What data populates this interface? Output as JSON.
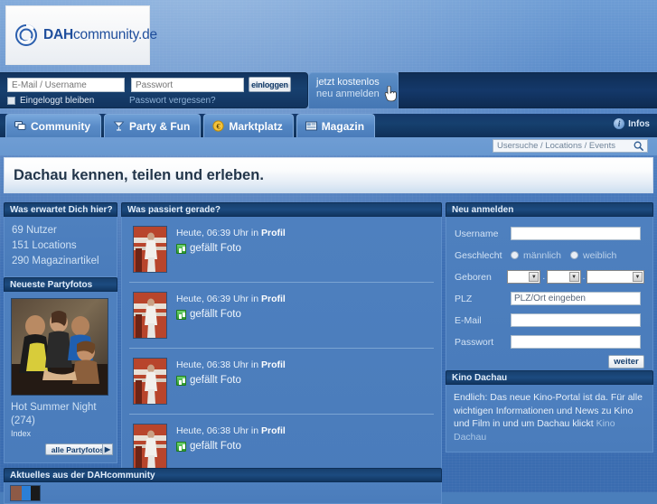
{
  "site": {
    "logo_main": "DAH",
    "logo_rest": "community.de",
    "logo_icon": "spiral-logo-icon"
  },
  "login": {
    "email_placeholder": "E-Mail / Username",
    "email_value": "",
    "password_placeholder": "Passwort",
    "password_value": "",
    "submit_label": "einloggen",
    "stay_logged_label": "Eingeloggt bleiben",
    "forgot_label": "Passwort vergessen?"
  },
  "cta": {
    "line1": "jetzt kostenlos",
    "line2": "neu anmelden",
    "cursor": "pointer-hand-cursor"
  },
  "nav": {
    "tabs": [
      {
        "label": "Community",
        "icon": "chat-bubbles-icon",
        "active": true
      },
      {
        "label": "Party & Fun",
        "icon": "cocktail-glass-icon",
        "active": false
      },
      {
        "label": "Marktplatz",
        "icon": "euro-coin-icon",
        "active": false
      },
      {
        "label": "Magazin",
        "icon": "newspaper-icon",
        "active": false
      }
    ],
    "infos_label": "Infos",
    "infos_icon": "info-circle-icon"
  },
  "search": {
    "placeholder": "Usersuche / Locations / Events",
    "value": "",
    "icon": "search-magnifier-icon"
  },
  "claim": {
    "text": "Dachau kennen, teilen und erleben."
  },
  "panels": {
    "erwartet": {
      "title": "Was erwartet Dich hier?",
      "stats": [
        "69 Nutzer",
        "151 Locations",
        "290 Magazinartikel"
      ]
    },
    "partyfotos": {
      "title": "Neueste Partyfotos",
      "photo_alt": "party-group-photo",
      "caption": "Hot Summer Night",
      "count": "(274)",
      "index_label": "Index",
      "button_label": "alle Partyfotos",
      "button_arrow": "▶"
    },
    "feed": {
      "title": "Was passiert gerade?",
      "items": [
        {
          "meta_time": "Heute, 06:39 Uhr in ",
          "meta_target": "Profil",
          "action": "gefällt Foto",
          "action_icon": "thumbs-up-icon"
        },
        {
          "meta_time": "Heute, 06:39 Uhr in ",
          "meta_target": "Profil",
          "action": "gefällt Foto",
          "action_icon": "thumbs-up-icon"
        },
        {
          "meta_time": "Heute, 06:38 Uhr in ",
          "meta_target": "Profil",
          "action": "gefällt Foto",
          "action_icon": "thumbs-up-icon"
        },
        {
          "meta_time": "Heute, 06:38 Uhr in ",
          "meta_target": "Profil",
          "action": "gefällt Foto",
          "action_icon": "thumbs-up-icon"
        }
      ]
    },
    "register": {
      "title": "Neu anmelden",
      "username_label": "Username",
      "username_value": "",
      "gender_label": "Geschlecht",
      "gender_male": "männlich",
      "gender_female": "weiblich",
      "born_label": "Geboren",
      "born_day": "",
      "born_month": "",
      "born_year": "",
      "plz_label": "PLZ",
      "plz_value": "PLZ/Ort eingeben",
      "email_label": "E-Mail",
      "email_value": "",
      "password_label": "Passwort",
      "password_value": "",
      "submit_label": "weiter"
    },
    "kino": {
      "title": "Kino Dachau",
      "text": "Endlich: Das neue Kino-Portal ist da. Für alle wichtigen Informationen und News zu Kino und Film in und um Dachau klickt ",
      "link": "Kino Dachau"
    },
    "bottom": {
      "title": "Aktuelles aus der DAHcommunity"
    }
  },
  "colors": {
    "page_blue": "#4a7ebb",
    "dark_navy": "#12345f",
    "panel_header": "#173f6d",
    "accent_light": "#cfe1f4",
    "logo_blue": "#1f4e9c"
  }
}
